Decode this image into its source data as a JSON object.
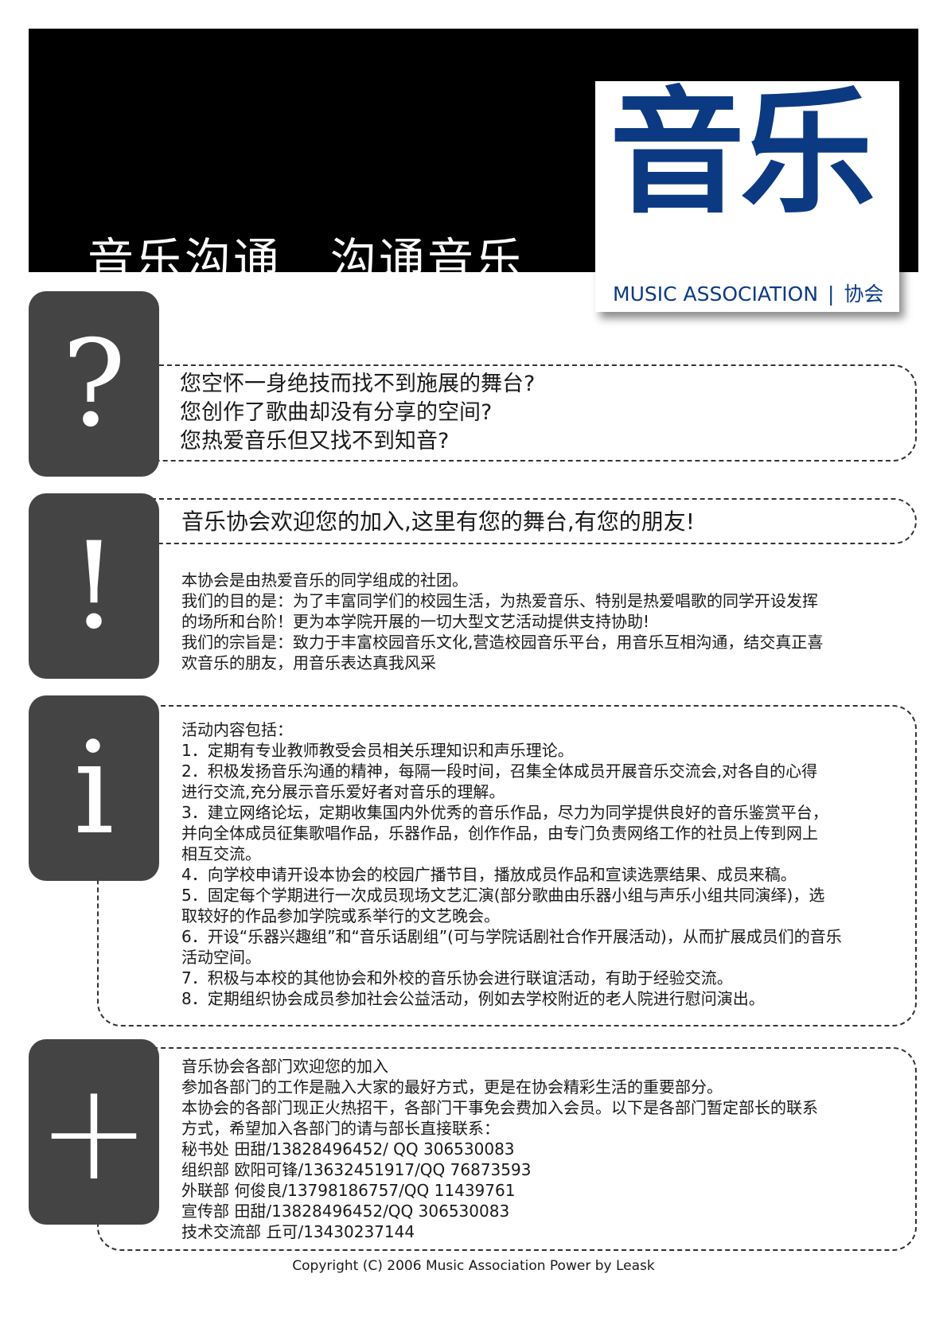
{
  "banner": {
    "slogan": "音乐沟通　沟通音乐",
    "logo_big": "音乐",
    "logo_sub_en": "MUSIC ASSOCIATION",
    "logo_sep": "|",
    "logo_sub_cn": "协会"
  },
  "icons": {
    "question": "?",
    "exclaim": "!",
    "info": "i",
    "plus": "+"
  },
  "questions": [
    "您空怀一身绝技而找不到施展的舞台?",
    "您创作了歌曲却没有分享的空间?",
    "您热爱音乐但又找不到知音?"
  ],
  "welcome": "音乐协会欢迎您的加入,这里有您的舞台,有您的朋友!",
  "about": [
    "本协会是由热爱音乐的同学组成的社团。",
    "我们的目的是：为了丰富同学们的校园生活，为热爱音乐、特别是热爱唱歌的同学开设发挥",
    "的场所和台阶！更为本学院开展的一切大型文艺活动提供支持协助!",
    "我们的宗旨是：致力于丰富校园音乐文化,营造校园音乐平台，用音乐互相沟通，结交真正喜",
    "欢音乐的朋友，用音乐表达真我风采"
  ],
  "activities": [
    "活动内容包括：",
    "1．定期有专业教师教受会员相关乐理知识和声乐理论。",
    "2．积极发扬音乐沟通的精神，每隔一段时间，召集全体成员开展音乐交流会,对各自的心得",
    "进行交流,充分展示音乐爱好者对音乐的理解。",
    "3．建立网络论坛，定期收集国内外优秀的音乐作品，尽力为同学提供良好的音乐鉴赏平台，",
    "并向全体成员征集歌唱作品，乐器作品，创作作品，由专门负责网络工作的社员上传到网上",
    "相互交流。",
    "4．向学校申请开设本协会的校园广播节目，播放成员作品和宣读选票结果、成员来稿。",
    "5．固定每个学期进行一次成员现场文艺汇演(部分歌曲由乐器小组与声乐小组共同演绎)，选",
    "取较好的作品参加学院或系举行的文艺晚会。",
    "6．开设“乐器兴趣组”和“音乐话剧组”(可与学院话剧社合作开展活动)，从而扩展成员们的音乐",
    "活动空间。",
    "7．积极与本校的其他协会和外校的音乐协会进行联谊活动，有助于经验交流。",
    "8．定期组织协会成员参加社会公益活动，例如去学校附近的老人院进行慰问演出。"
  ],
  "departments": [
    "音乐协会各部门欢迎您的加入",
    "参加各部门的工作是融入大家的最好方式，更是在协会精彩生活的重要部分。",
    "本协会的各部门现正火热招干，各部门干事免会费加入会员。以下是各部门暂定部长的联系",
    "方式，希望加入各部门的请与部长直接联系：",
    "秘书处  田甜/13828496452/ QQ 306530083",
    "组织部  欧阳可锋/13632451917/QQ 76873593",
    "外联部  何俊良/13798186757/QQ 11439761",
    "宣传部  田甜/13828496452/QQ 306530083",
    "技术交流部  丘可/13430237144"
  ],
  "footer": "Copyright (C) 2006 Music Association   Power by Leask"
}
